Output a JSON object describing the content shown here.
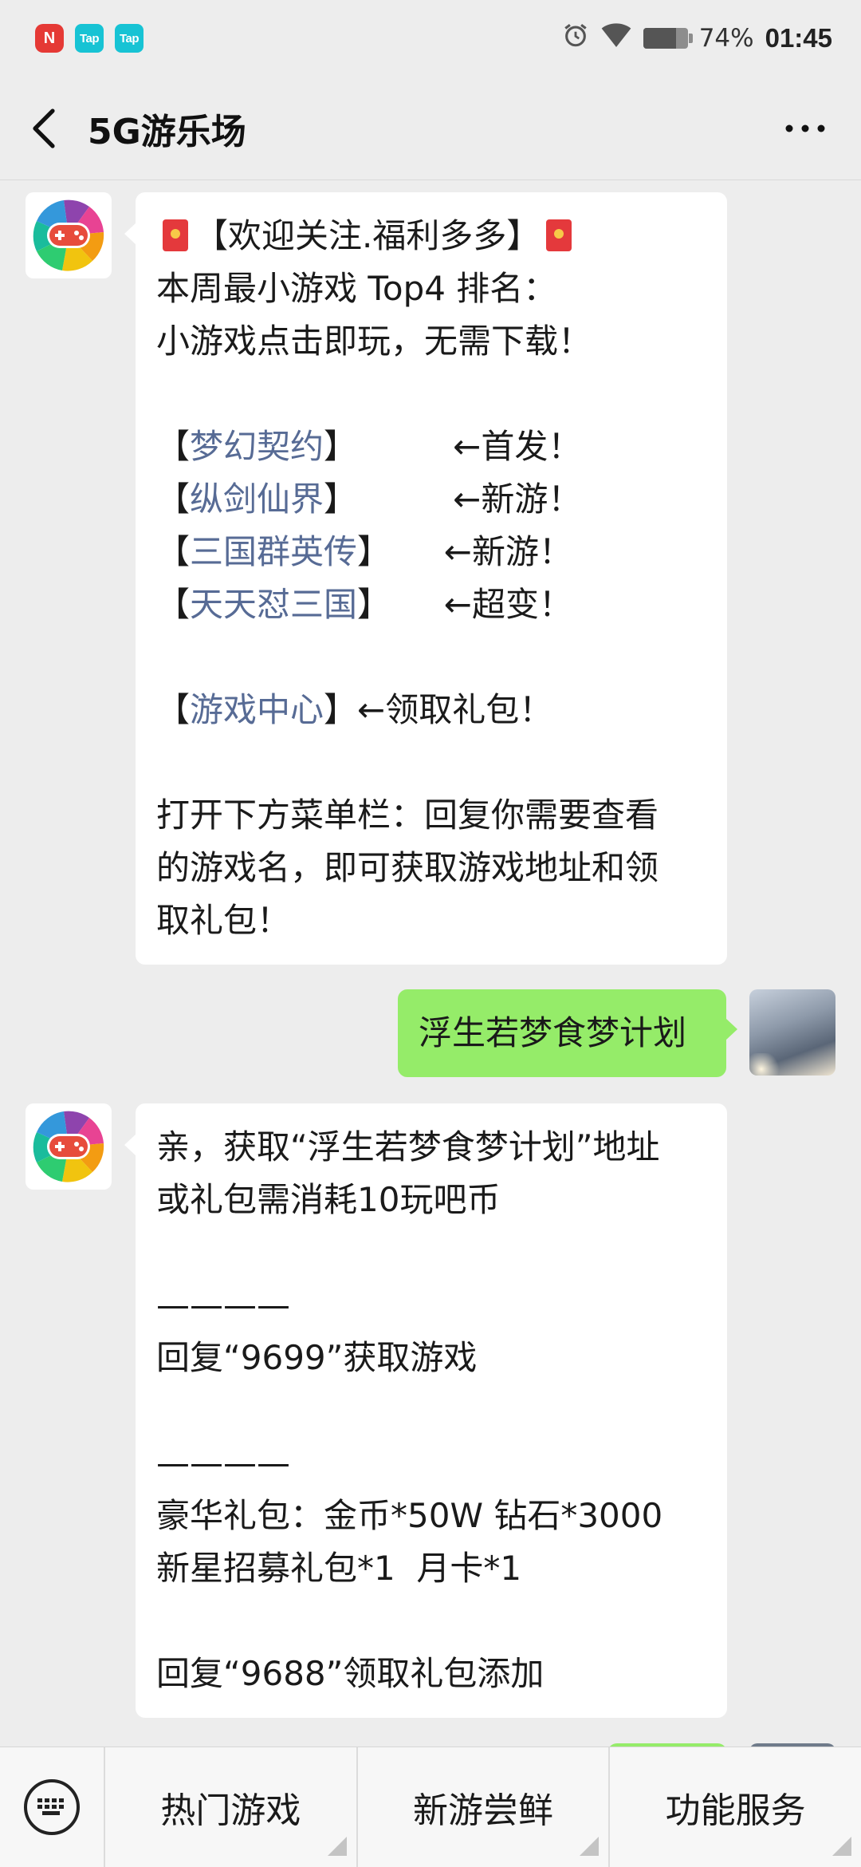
{
  "status_bar": {
    "apps": [
      "N",
      "Tap",
      "Tap"
    ],
    "battery_percent": "74%",
    "battery_level": 0.74,
    "time": "01:45"
  },
  "header": {
    "title": "5G游乐场"
  },
  "messages": [
    {
      "side": "left",
      "lines": [
        {
          "parts": [
            {
              "t": "",
              "redpack": true
            },
            {
              "t": "【欢迎关注.福利多多】"
            },
            {
              "t": "",
              "redpack": true
            }
          ]
        },
        {
          "parts": [
            {
              "t": "本周最小游戏 Top4 排名："
            }
          ]
        },
        {
          "parts": [
            {
              "t": "小游戏点击即玩，无需下载！"
            }
          ]
        },
        {
          "parts": [
            {
              "t": " "
            }
          ]
        },
        {
          "parts": [
            {
              "t": "【"
            },
            {
              "t": "梦幻契约",
              "link": true
            },
            {
              "t": "】         ←首发！"
            }
          ]
        },
        {
          "parts": [
            {
              "t": "【"
            },
            {
              "t": "纵剑仙界",
              "link": true
            },
            {
              "t": "】         ←新游！"
            }
          ]
        },
        {
          "parts": [
            {
              "t": "【"
            },
            {
              "t": "三国群英传",
              "link": true
            },
            {
              "t": "】     ←新游！"
            }
          ]
        },
        {
          "parts": [
            {
              "t": "【"
            },
            {
              "t": "天天怼三国",
              "link": true
            },
            {
              "t": "】     ←超变！"
            }
          ]
        },
        {
          "parts": [
            {
              "t": " "
            }
          ]
        },
        {
          "parts": [
            {
              "t": "【"
            },
            {
              "t": "游戏中心",
              "link": true
            },
            {
              "t": "】←领取礼包！"
            }
          ]
        },
        {
          "parts": [
            {
              "t": " "
            }
          ]
        },
        {
          "parts": [
            {
              "t": "打开下方菜单栏：回复你需要查看"
            }
          ]
        },
        {
          "parts": [
            {
              "t": "的游戏名，即可获取游戏地址和领"
            }
          ]
        },
        {
          "parts": [
            {
              "t": "取礼包！"
            }
          ]
        }
      ]
    },
    {
      "side": "right",
      "lines": [
        {
          "parts": [
            {
              "t": "浮生若梦食梦计划"
            }
          ]
        }
      ]
    },
    {
      "side": "left",
      "lines": [
        {
          "parts": [
            {
              "t": "亲，获取“浮生若梦食梦计划”地址"
            }
          ]
        },
        {
          "parts": [
            {
              "t": "或礼包需消耗10玩吧币"
            }
          ]
        },
        {
          "parts": [
            {
              "t": " "
            }
          ]
        },
        {
          "parts": [
            {
              "t": "————"
            }
          ]
        },
        {
          "parts": [
            {
              "t": "回复“9699”获取游戏"
            }
          ]
        },
        {
          "parts": [
            {
              "t": " "
            }
          ]
        },
        {
          "parts": [
            {
              "t": "————"
            }
          ]
        },
        {
          "parts": [
            {
              "t": "豪华礼包：金币*50W 钻石*3000"
            }
          ]
        },
        {
          "parts": [
            {
              "t": "新星招募礼包*1  月卡*1"
            }
          ]
        },
        {
          "parts": [
            {
              "t": " "
            }
          ]
        },
        {
          "parts": [
            {
              "t": "回复“9688”领取礼包添加"
            }
          ]
        }
      ]
    }
  ],
  "bottom_menu": {
    "items": [
      "热门游戏",
      "新游尝鲜",
      "功能服务"
    ]
  },
  "colors": {
    "background": "#ededed",
    "bubble_self": "#95ec69",
    "link": "#576b95"
  }
}
